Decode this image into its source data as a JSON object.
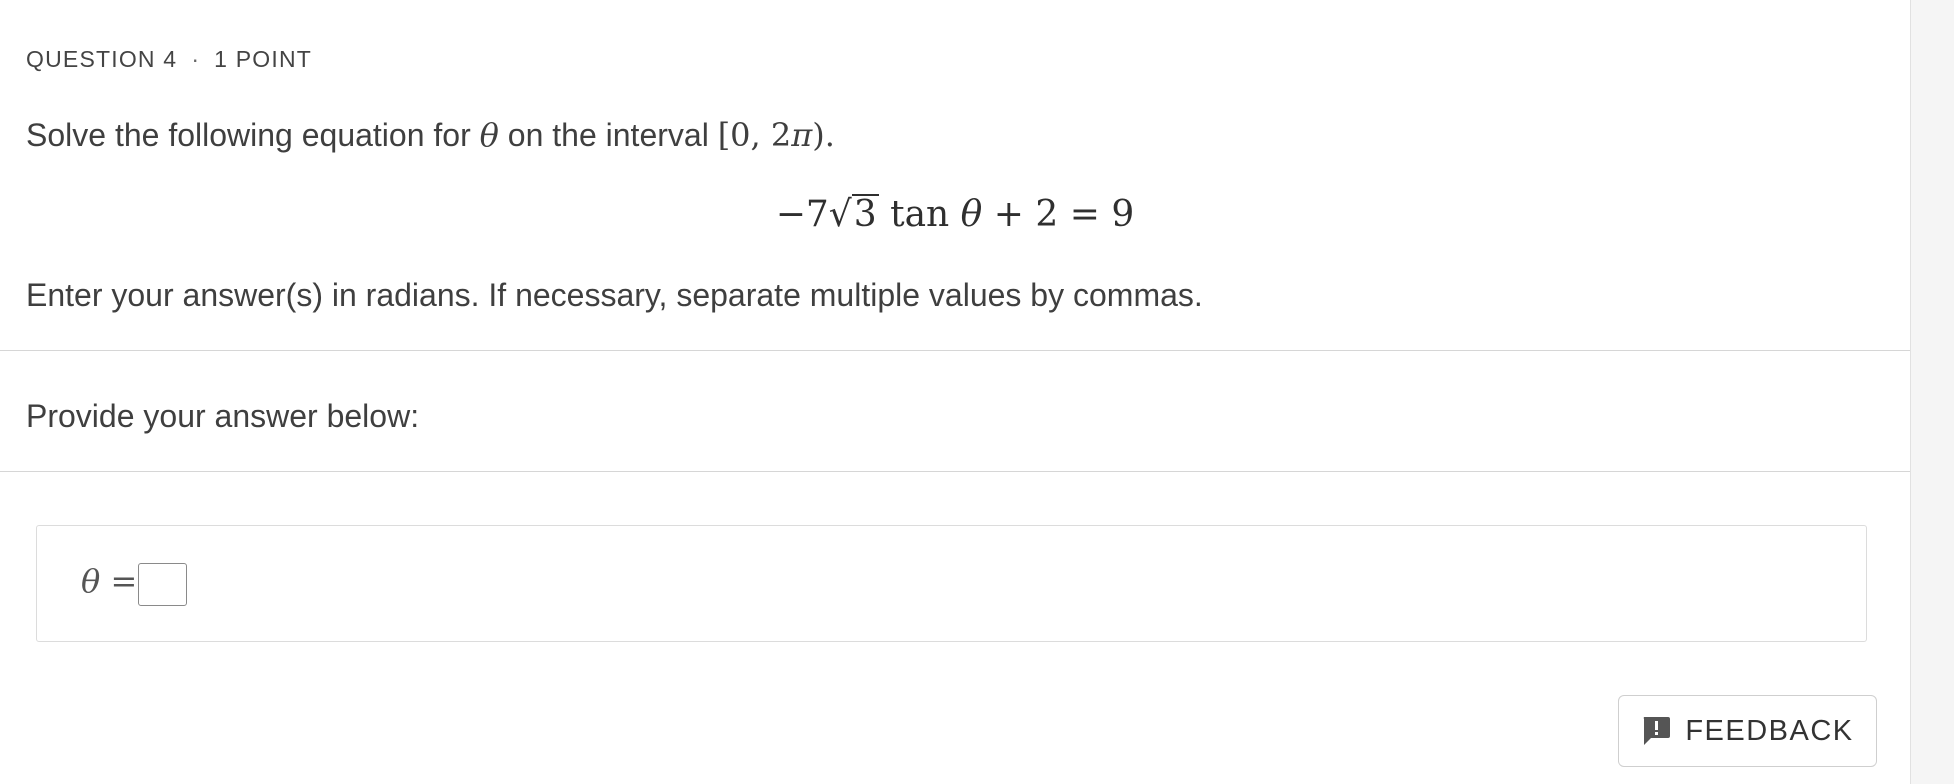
{
  "question": {
    "number_label": "QUESTION 4",
    "separator": "·",
    "points_label": "1 POINT"
  },
  "prompt": {
    "text_before": "Solve the following equation for ",
    "variable": "θ",
    "text_middle": " on the interval ",
    "interval": "[0, 2",
    "interval_pi": "π",
    "interval_end": ").",
    "equation": {
      "lead": "−7",
      "radicand": "3",
      "func": " tan ",
      "variable": "θ",
      "rest": " + 2 = 9"
    },
    "instructions": "Enter your answer(s) in radians. If necessary, separate multiple values by commas."
  },
  "answer_section": {
    "heading": "Provide your answer below:",
    "variable": "θ",
    "equals": " = ",
    "input_value": ""
  },
  "feedback": {
    "label": "FEEDBACK",
    "icon": "feedback-icon"
  }
}
